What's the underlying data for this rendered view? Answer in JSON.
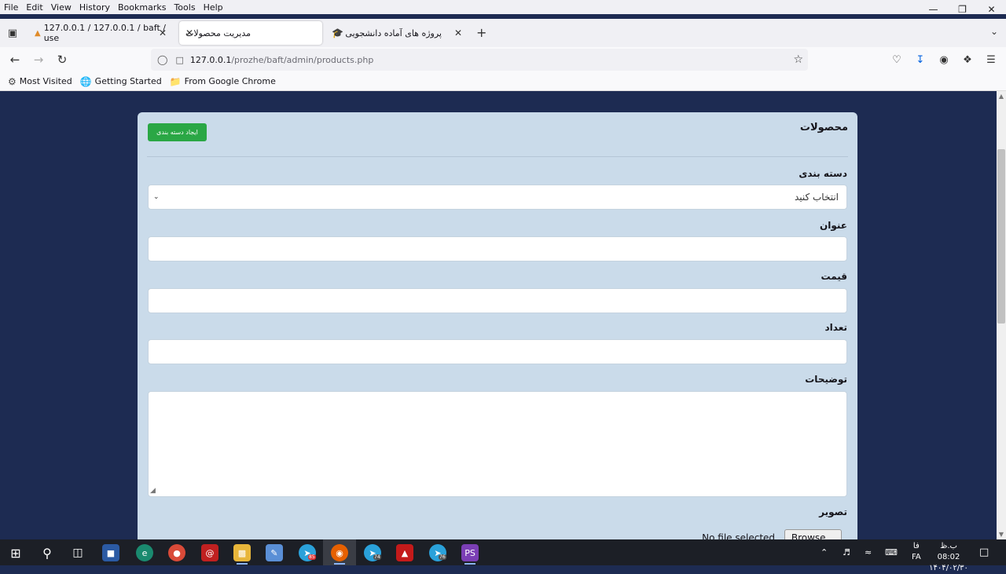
{
  "menubar": {
    "items": [
      "File",
      "Edit",
      "View",
      "History",
      "Bookmarks",
      "Tools",
      "Help"
    ]
  },
  "tabs": [
    {
      "title": "127.0.0.1 / 127.0.0.1 / baft / use",
      "active": false
    },
    {
      "title": "مدیریت محصولات",
      "active": true
    },
    {
      "title": "پروژه های آماده دانشجویی",
      "active": false
    }
  ],
  "urlbar": {
    "host": "127.0.0.1",
    "path": "/prozhe/baft/admin/products.php"
  },
  "bookmarks": [
    "Most Visited",
    "Getting Started",
    "From Google Chrome"
  ],
  "page": {
    "title": "محصولات",
    "create_button": "ایجاد دسته بندی",
    "category_label": "دسته بندی",
    "category_value": "انتخاب کنید",
    "title_label": "عنوان",
    "price_label": "قیمت",
    "count_label": "تعداد",
    "description_label": "توضیحات",
    "image_label": "تصویر",
    "file_status": "No file selected.",
    "browse_label": "Browse..."
  },
  "taskbar": {
    "telegram_badge_1": "85",
    "telegram_badge_2": "74",
    "telegram_badge_3": "76",
    "lang": "FA",
    "lang_top": "فا",
    "time": "ب.ظ 08:02",
    "date": "۱۴۰۴/۰۲/۳۰"
  },
  "colors": {
    "page_bg": "#1d2b52",
    "card_bg": "#cadbea",
    "create_button": "#2aa745"
  }
}
